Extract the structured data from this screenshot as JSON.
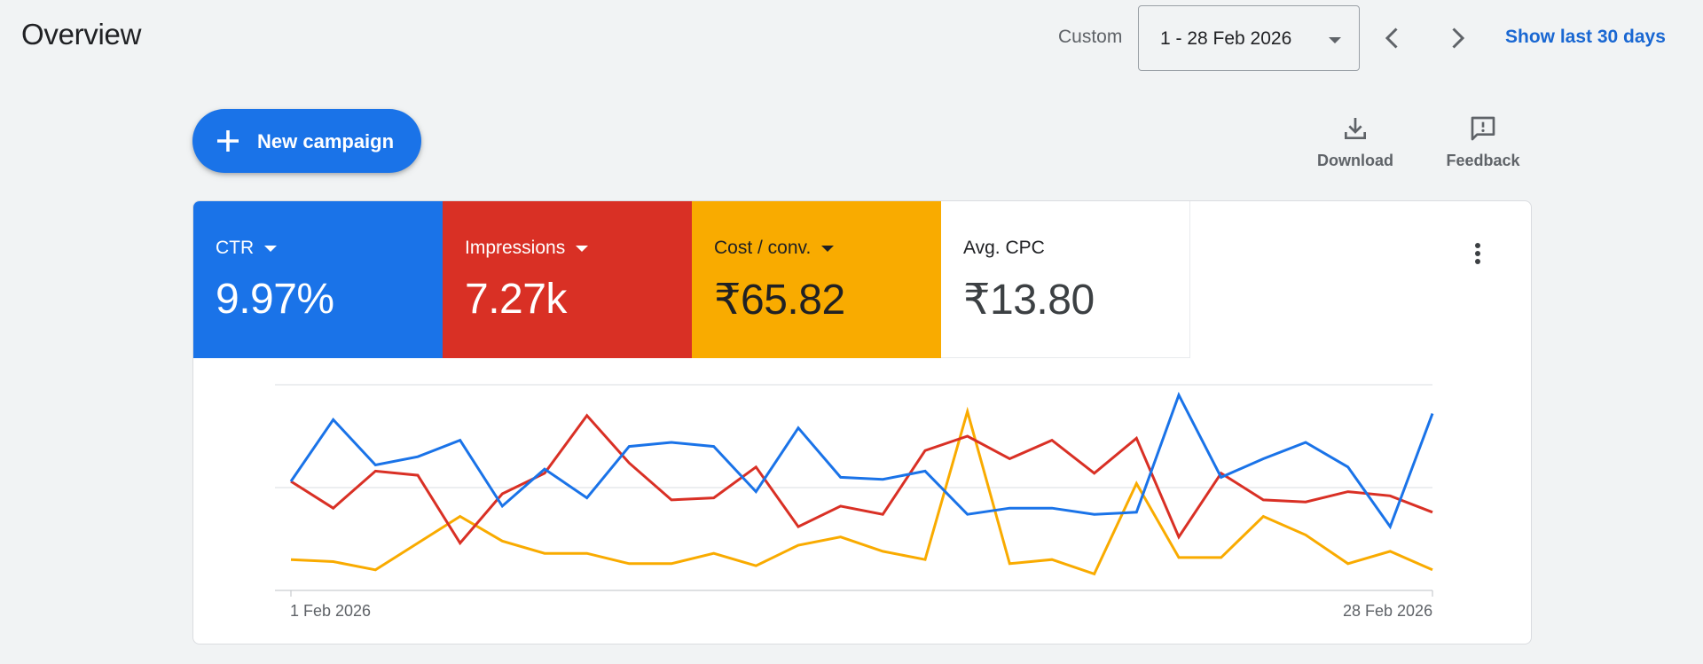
{
  "header": {
    "title": "Overview",
    "date_label": "Custom",
    "date_range": "1 - 28 Feb 2026",
    "show_last": "Show last 30 days"
  },
  "toolbar": {
    "new_campaign_label": "New campaign",
    "download_label": "Download",
    "feedback_label": "Feedback"
  },
  "metrics": [
    {
      "label": "CTR",
      "value": "9.97%",
      "color": "#1a73e8"
    },
    {
      "label": "Impressions",
      "value": "7.27k",
      "color": "#d93025"
    },
    {
      "label": "Cost / conv.",
      "value": "₹65.82",
      "color": "#f9ab00"
    },
    {
      "label": "Avg. CPC",
      "value": "₹13.80"
    }
  ],
  "icons": [
    "plus-icon",
    "download-icon",
    "feedback-icon",
    "more-vert-icon",
    "chevron-left-icon",
    "chevron-right-icon",
    "caret-down-icon"
  ],
  "chart_data": {
    "type": "line",
    "x": [
      "1 Feb 2026",
      "2 Feb 2026",
      "3 Feb 2026",
      "4 Feb 2026",
      "5 Feb 2026",
      "6 Feb 2026",
      "7 Feb 2026",
      "8 Feb 2026",
      "9 Feb 2026",
      "10 Feb 2026",
      "11 Feb 2026",
      "12 Feb 2026",
      "13 Feb 2026",
      "14 Feb 2026",
      "15 Feb 2026",
      "16 Feb 2026",
      "17 Feb 2026",
      "18 Feb 2026",
      "19 Feb 2026",
      "20 Feb 2026",
      "21 Feb 2026",
      "22 Feb 2026",
      "23 Feb 2026",
      "24 Feb 2026",
      "25 Feb 2026",
      "26 Feb 2026",
      "27 Feb 2026",
      "28 Feb 2026"
    ],
    "x_tick_labels": [
      "1 Feb 2026",
      "28 Feb 2026"
    ],
    "ylim": [
      0,
      100
    ],
    "grid": true,
    "series": [
      {
        "name": "CTR",
        "color": "#1a73e8",
        "values": [
          53,
          83,
          61,
          65,
          73,
          41,
          59,
          45,
          70,
          72,
          70,
          48,
          79,
          55,
          54,
          58,
          37,
          40,
          40,
          37,
          38,
          95,
          55,
          64,
          72,
          60,
          31,
          86
        ]
      },
      {
        "name": "Impressions",
        "color": "#d93025",
        "values": [
          53,
          40,
          58,
          56,
          23,
          47,
          57,
          85,
          62,
          44,
          45,
          60,
          31,
          41,
          37,
          68,
          75,
          64,
          73,
          57,
          74,
          26,
          57,
          44,
          43,
          48,
          46,
          38
        ]
      },
      {
        "name": "Cost / conv.",
        "color": "#f9ab00",
        "values": [
          15,
          14,
          10,
          23,
          36,
          24,
          18,
          18,
          13,
          13,
          18,
          12,
          22,
          26,
          19,
          15,
          87,
          13,
          15,
          8,
          52,
          16,
          16,
          36,
          27,
          13,
          19,
          10
        ]
      }
    ]
  }
}
